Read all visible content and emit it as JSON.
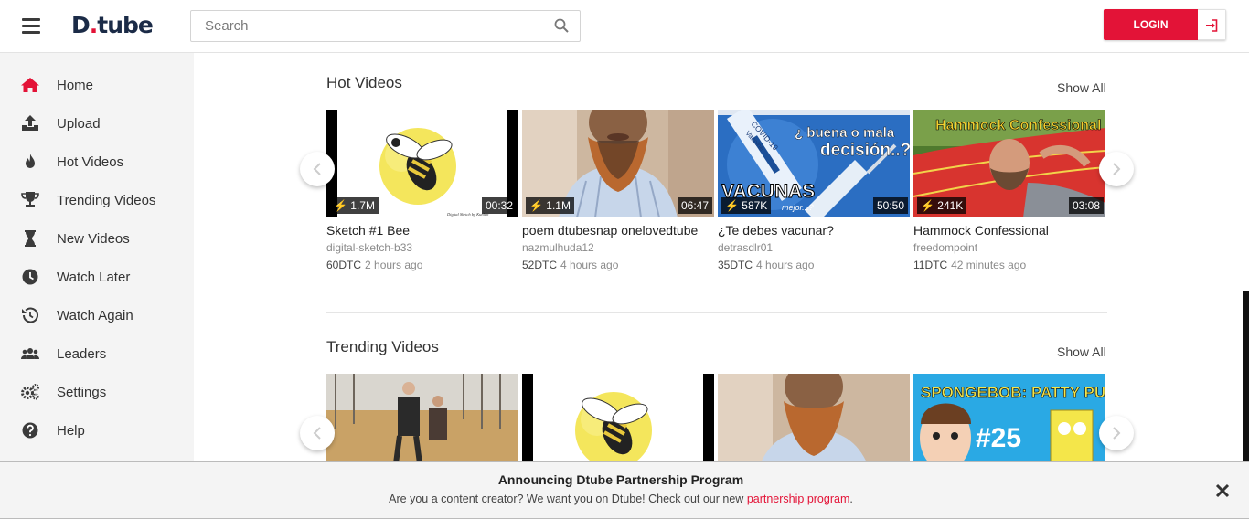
{
  "header": {
    "logo_main": "D",
    "logo_dot": ".",
    "logo_rest": "tube",
    "search_placeholder": "Search",
    "login_label": "LOGIN"
  },
  "colors": {
    "accent": "#e31337",
    "logo_dark": "#1b2b47",
    "sidebar_bg": "#f4f4f4"
  },
  "sidebar": {
    "items": [
      {
        "label": "Home",
        "icon": "home-icon"
      },
      {
        "label": "Upload",
        "icon": "upload-icon"
      },
      {
        "label": "Hot Videos",
        "icon": "flame-icon"
      },
      {
        "label": "Trending Videos",
        "icon": "trophy-icon"
      },
      {
        "label": "New Videos",
        "icon": "hourglass-icon"
      },
      {
        "label": "Watch Later",
        "icon": "clock-icon"
      },
      {
        "label": "Watch Again",
        "icon": "history-icon"
      },
      {
        "label": "Leaders",
        "icon": "users-icon"
      },
      {
        "label": "Settings",
        "icon": "gears-icon"
      },
      {
        "label": "Help",
        "icon": "question-icon"
      }
    ]
  },
  "hot": {
    "title": "Hot Videos",
    "show_all": "Show All",
    "videos": [
      {
        "title": "Sketch #1 Bee",
        "author": "digital-sketch-b33",
        "dtc": "60DTC",
        "ago": "2 hours ago",
        "views": "1.7M",
        "duration": "00:32"
      },
      {
        "title": "poem dtubesnap onelovedtube",
        "author": "nazmulhuda12",
        "dtc": "52DTC",
        "ago": "4 hours ago",
        "views": "1.1M",
        "duration": "06:47"
      },
      {
        "title": "¿Te debes vacunar?",
        "author": "detrasdlr01",
        "dtc": "35DTC",
        "ago": "4 hours ago",
        "views": "587K",
        "duration": "50:50"
      },
      {
        "title": "Hammock Confessional",
        "author": "freedompoint",
        "dtc": "11DTC",
        "ago": "42 minutes ago",
        "views": "241K",
        "duration": "03:08"
      }
    ]
  },
  "thumb_text": {
    "bee_credit": "Digital Sketch by Kunlun",
    "covid_top": "COVID-19",
    "covid_vaccine": "Vaccine",
    "covid_q1": "¿ buena o mala",
    "covid_q2": "decisión..?",
    "covid_vacunas": "VACUNAS",
    "covid_mejor": "mejor...?",
    "hammock_title": "Hammock Confessional",
    "sponge_title": "SPONGEBOB: PATTY PURSUIT",
    "sponge_ep": "#25"
  },
  "trending": {
    "title": "Trending Videos",
    "show_all": "Show All"
  },
  "banner": {
    "title": "Announcing Dtube Partnership Program",
    "text": "Are you a content creator? We want you on Dtube! Check out our new ",
    "link": "partnership program",
    "end": "."
  }
}
